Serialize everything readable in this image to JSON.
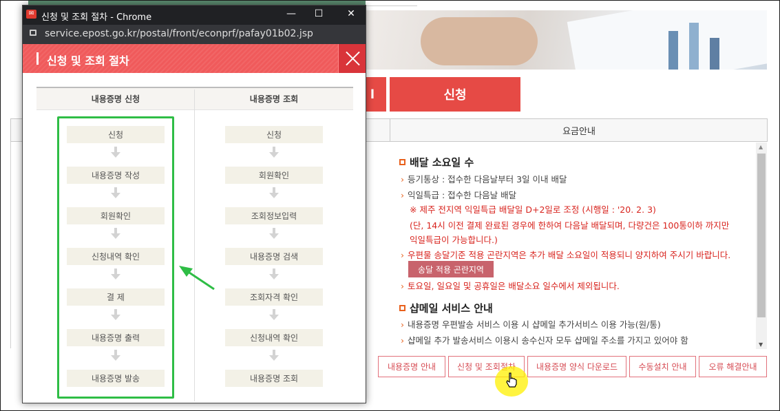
{
  "popup": {
    "window_title": "신청 및 조회 절차 - Chrome",
    "url": "service.epost.go.kr/postal/front/econprf/pafay01b02.jsp",
    "header_title": "신청 및 조회 절차",
    "columns": [
      {
        "title": "내용증명 신청",
        "steps": [
          "신청",
          "내용증명 작성",
          "회원확인",
          "신청내역 확인",
          "결 제",
          "내용증명 출력",
          "내용증명 발송"
        ]
      },
      {
        "title": "내용증명 조회",
        "steps": [
          "신청",
          "회원확인",
          "조회정보입력",
          "내용증명 검색",
          "조회자격 확인",
          "신청내역 확인",
          "내용증명 조회"
        ]
      }
    ]
  },
  "background": {
    "apply_button": "신청",
    "left_button_fragment": "l",
    "fee_tab": "요금안내",
    "delivery_section": {
      "title": "배달 소요일 수",
      "line1": "등기통상 : 접수한 다음날부터 3일 이내 배달",
      "line2": "익일특급 : 접수한 다음날 배달",
      "note1": "※ 제주 전지역 익일특급 배달일 D+2일로 조정 (시행일 : '20. 2. 3)",
      "note2": "(단, 14시 이전 결제 완료된 경우에 한하여 다음날 배달되며, 다량건은 100통이하 까지만",
      "note3": "익일특급이 가능합니다.)",
      "line3": "우편물 송달기준 적용 곤란지역은 추가 배달 소요일이 적용되니 양지하여 주시기 바랍니다.",
      "region_button": "송달 적용 곤란지역",
      "line4": "토요일, 일요일 및 공휴일은 배달소요 일수에서 제외됩니다."
    },
    "shop_section": {
      "title": "샵메일 서비스 안내",
      "line1": "내용증명 우편발송 서비스 이용 시 샵메일 추가서비스 이용 가능(원/통)",
      "line2": "샵메일 추가 발송서비스 이용시 송수신자 모두 샵메일 주소를 가지고 있어야 함"
    },
    "bottom_nav": [
      "내용증명 안내",
      "신청 및 조회절차",
      "내용증명 양식 다운로드",
      "수동설치 안내",
      "오류 해결안내"
    ]
  },
  "colors": {
    "header_red": "#f05a5b",
    "button_red": "#e64a45",
    "highlight_green": "#2ebd45",
    "accent_orange": "#e8601c"
  },
  "icons": {
    "favicon": "epost-logo-icon",
    "lock": "lock-icon",
    "close": "close-icon",
    "cursor": "hand-cursor-icon"
  }
}
